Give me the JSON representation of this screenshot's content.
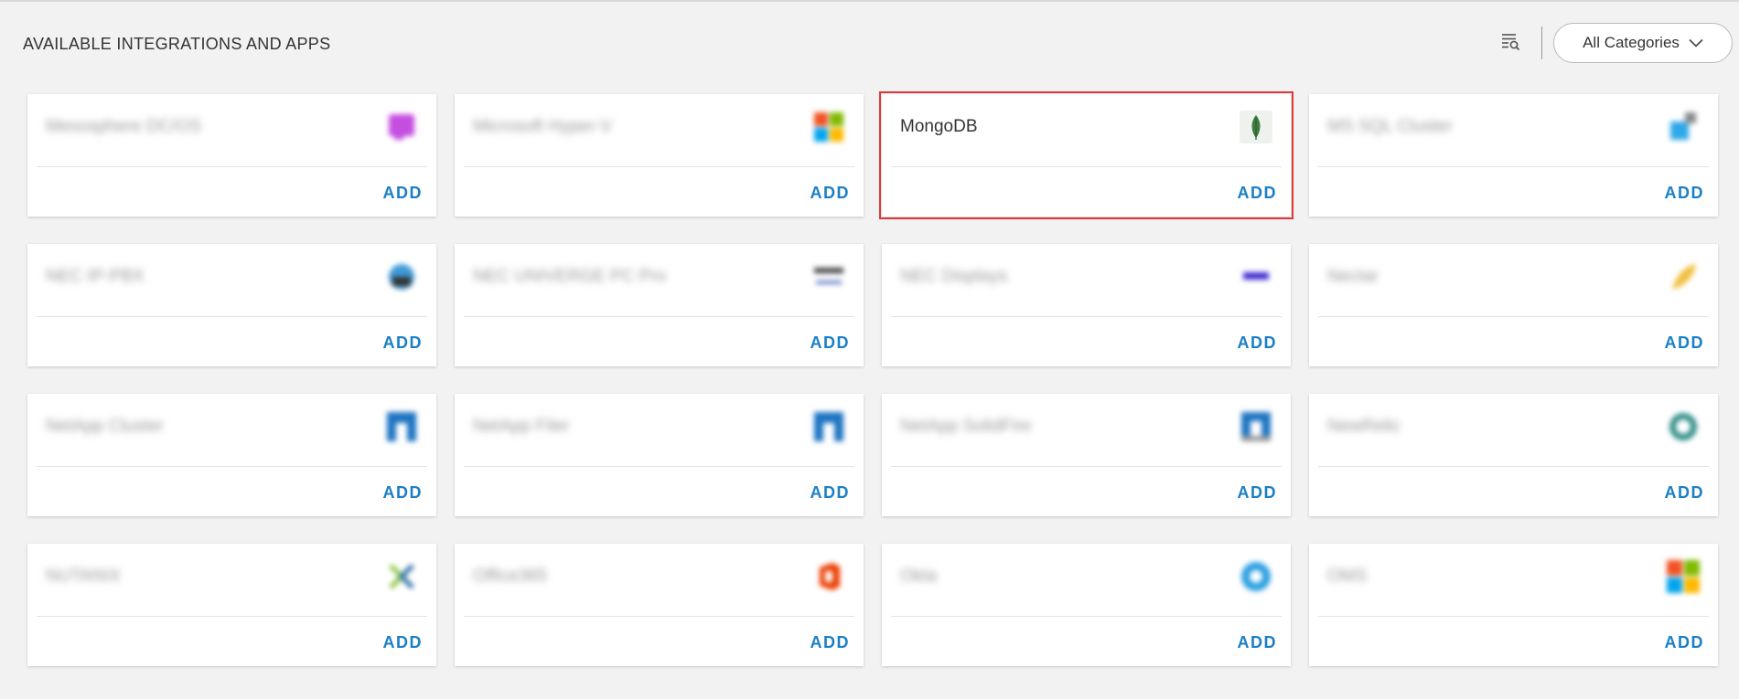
{
  "header": {
    "title": "AVAILABLE INTEGRATIONS AND APPS",
    "filter_icon": "filter-list-search-icon",
    "category_select": {
      "selected": "All Categories",
      "icon": "chevron-down-icon"
    }
  },
  "colors": {
    "background": "#f2f2f2",
    "card": "#ffffff",
    "accent": "#1a7fc7",
    "selected_outline": "#e0383a"
  },
  "cards": [
    {
      "name": "Mesosphere DC/OS",
      "logo": "mesosphere-logo",
      "action": "ADD",
      "selected": false
    },
    {
      "name": "Microsoft Hyper-V",
      "logo": "microsoft-logo",
      "action": "ADD",
      "selected": false
    },
    {
      "name": "MongoDB",
      "logo": "mongodb-leaf-logo",
      "action": "ADD",
      "selected": true
    },
    {
      "name": "MS SQL Cluster",
      "logo": "ms-sql-cluster-logo",
      "action": "ADD",
      "selected": false
    },
    {
      "name": "NEC IP-PBX",
      "logo": "nec-ip-pbx-logo",
      "action": "ADD",
      "selected": false
    },
    {
      "name": "NEC UNIVERGE PC Pro",
      "logo": "nec-univerge-logo",
      "action": "ADD",
      "selected": false
    },
    {
      "name": "NEC Displays",
      "logo": "nec-logo",
      "action": "ADD",
      "selected": false
    },
    {
      "name": "Nectar",
      "logo": "nectar-logo",
      "action": "ADD",
      "selected": false
    },
    {
      "name": "NetApp Cluster",
      "logo": "netapp-logo",
      "action": "ADD",
      "selected": false
    },
    {
      "name": "NetApp Filer",
      "logo": "netapp-logo",
      "action": "ADD",
      "selected": false
    },
    {
      "name": "NetApp SolidFire",
      "logo": "netapp-solidfire-logo",
      "action": "ADD",
      "selected": false
    },
    {
      "name": "NewRelic",
      "logo": "newrelic-logo",
      "action": "ADD",
      "selected": false
    },
    {
      "name": "NUTANIX",
      "logo": "nutanix-logo",
      "action": "ADD",
      "selected": false
    },
    {
      "name": "Office365",
      "logo": "office365-logo",
      "action": "ADD",
      "selected": false
    },
    {
      "name": "Okta",
      "logo": "okta-logo",
      "action": "ADD",
      "selected": false
    },
    {
      "name": "OMS",
      "logo": "oms-logo",
      "action": "ADD",
      "selected": false
    }
  ]
}
